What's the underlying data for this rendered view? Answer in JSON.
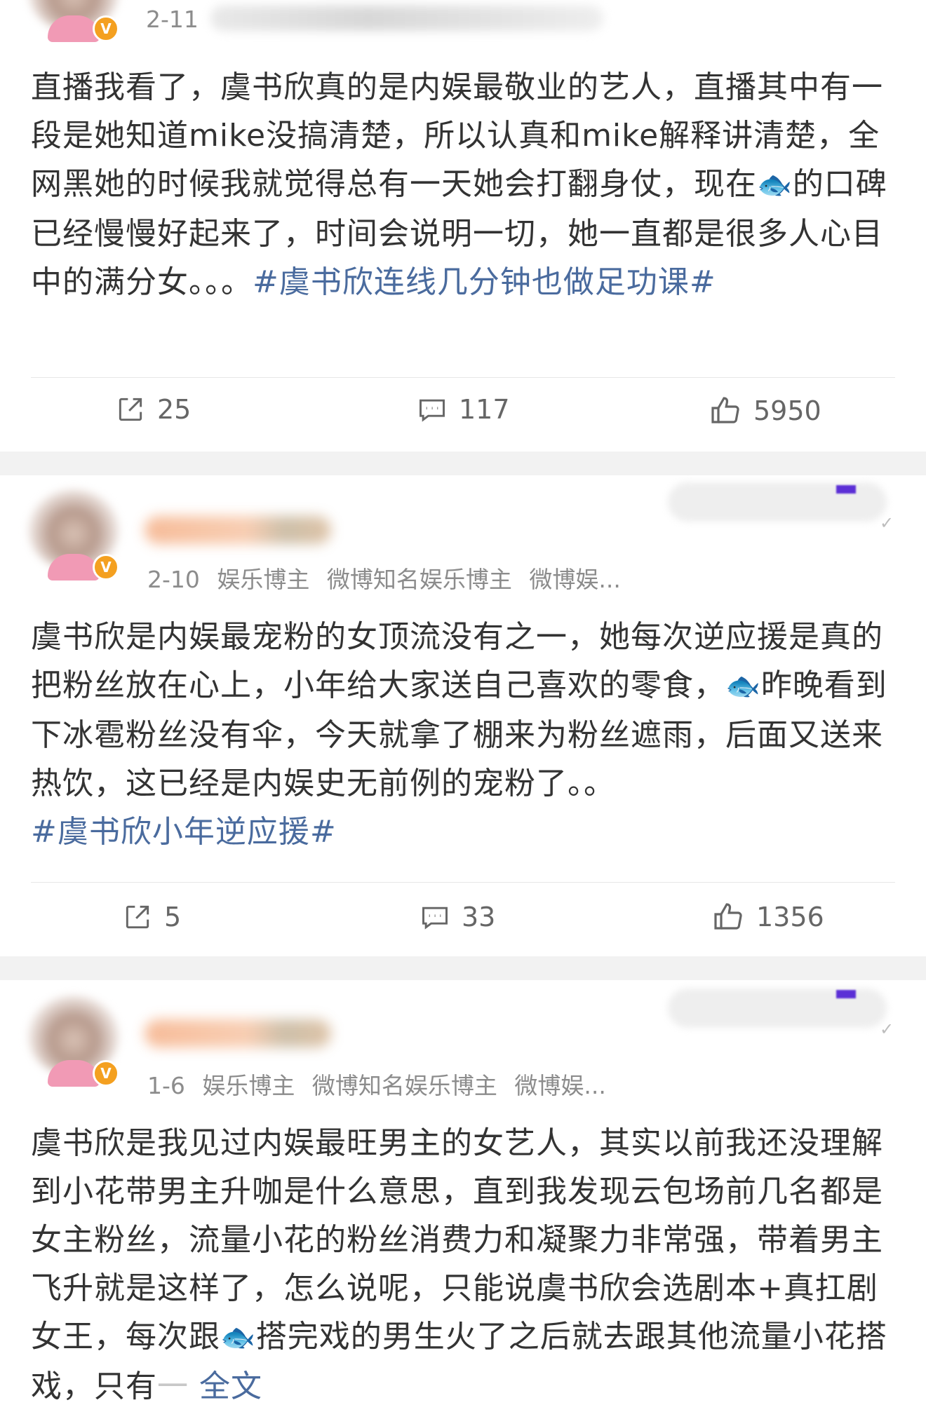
{
  "posts": [
    {
      "date": "2-11",
      "tags": [],
      "text_before_emoji": "直播我看了，虞书欣真的是内娱最敬业的艺人，直播其中有一段是她知道mike没搞清楚，所以认真和mike解释讲清楚，全网黑她的时候我就觉得总有一天她会打翻身仗，现在",
      "text_after_emoji": "的口碑已经慢慢好起来了，时间会说明一切，她一直都是很多人心目中的满分女。。。",
      "topic": "#虞书欣连线几分钟也做足功课#",
      "reposts": "25",
      "comments": "117",
      "likes": "5950"
    },
    {
      "date": "2-10",
      "tags": [
        "娱乐博主",
        "微博知名娱乐博主",
        "微博娱..."
      ],
      "text_before_emoji": "虞书欣是内娱最宠粉的女顶流没有之一，她每次逆应援是真的把粉丝放在心上，小年给大家送自己喜欢的零食，",
      "text_after_emoji": "昨晚看到下冰雹粉丝没有伞，今天就拿了棚来为粉丝遮雨，后面又送来热饮，这已经是内娱史无前例的宠粉了。。",
      "topic": "#虞书欣小年逆应援#",
      "reposts": "5",
      "comments": "33",
      "likes": "1356"
    },
    {
      "date": "1-6",
      "tags": [
        "娱乐博主",
        "微博知名娱乐博主",
        "微博娱..."
      ],
      "text_before_emoji": "虞书欣是我见过内娱最旺男主的女艺人，其实以前我还没理解到小花带男主升咖是什么意思，直到我发现云包场前几名都是女主粉丝，流量小花的粉丝消费力和凝聚力非常强，带着男主飞升就是这样了，怎么说呢，只能说虞书欣会选剧本+真扛剧女王，每次跟",
      "text_after_emoji": "搭完戏的男生火了之后就去跟其他流量小花搭戏，只有",
      "fade_text": "一",
      "more_label": "全文"
    }
  ],
  "icons": {
    "emoji": "fish-emoji-icon",
    "repost": "repost-icon",
    "comment": "comment-icon",
    "like": "thumbs-up-icon",
    "verified": "verified-v-badge-icon",
    "more": "chevron-check-icon"
  },
  "badge_symbol": "V",
  "fish_symbol": "🐟",
  "check_symbol": "✓",
  "colors": {
    "topic_link": "#4a6b9e",
    "meta_gray": "#8c8c8c",
    "separator": "#f2f2f2",
    "verified_badge": "#f4a020"
  }
}
